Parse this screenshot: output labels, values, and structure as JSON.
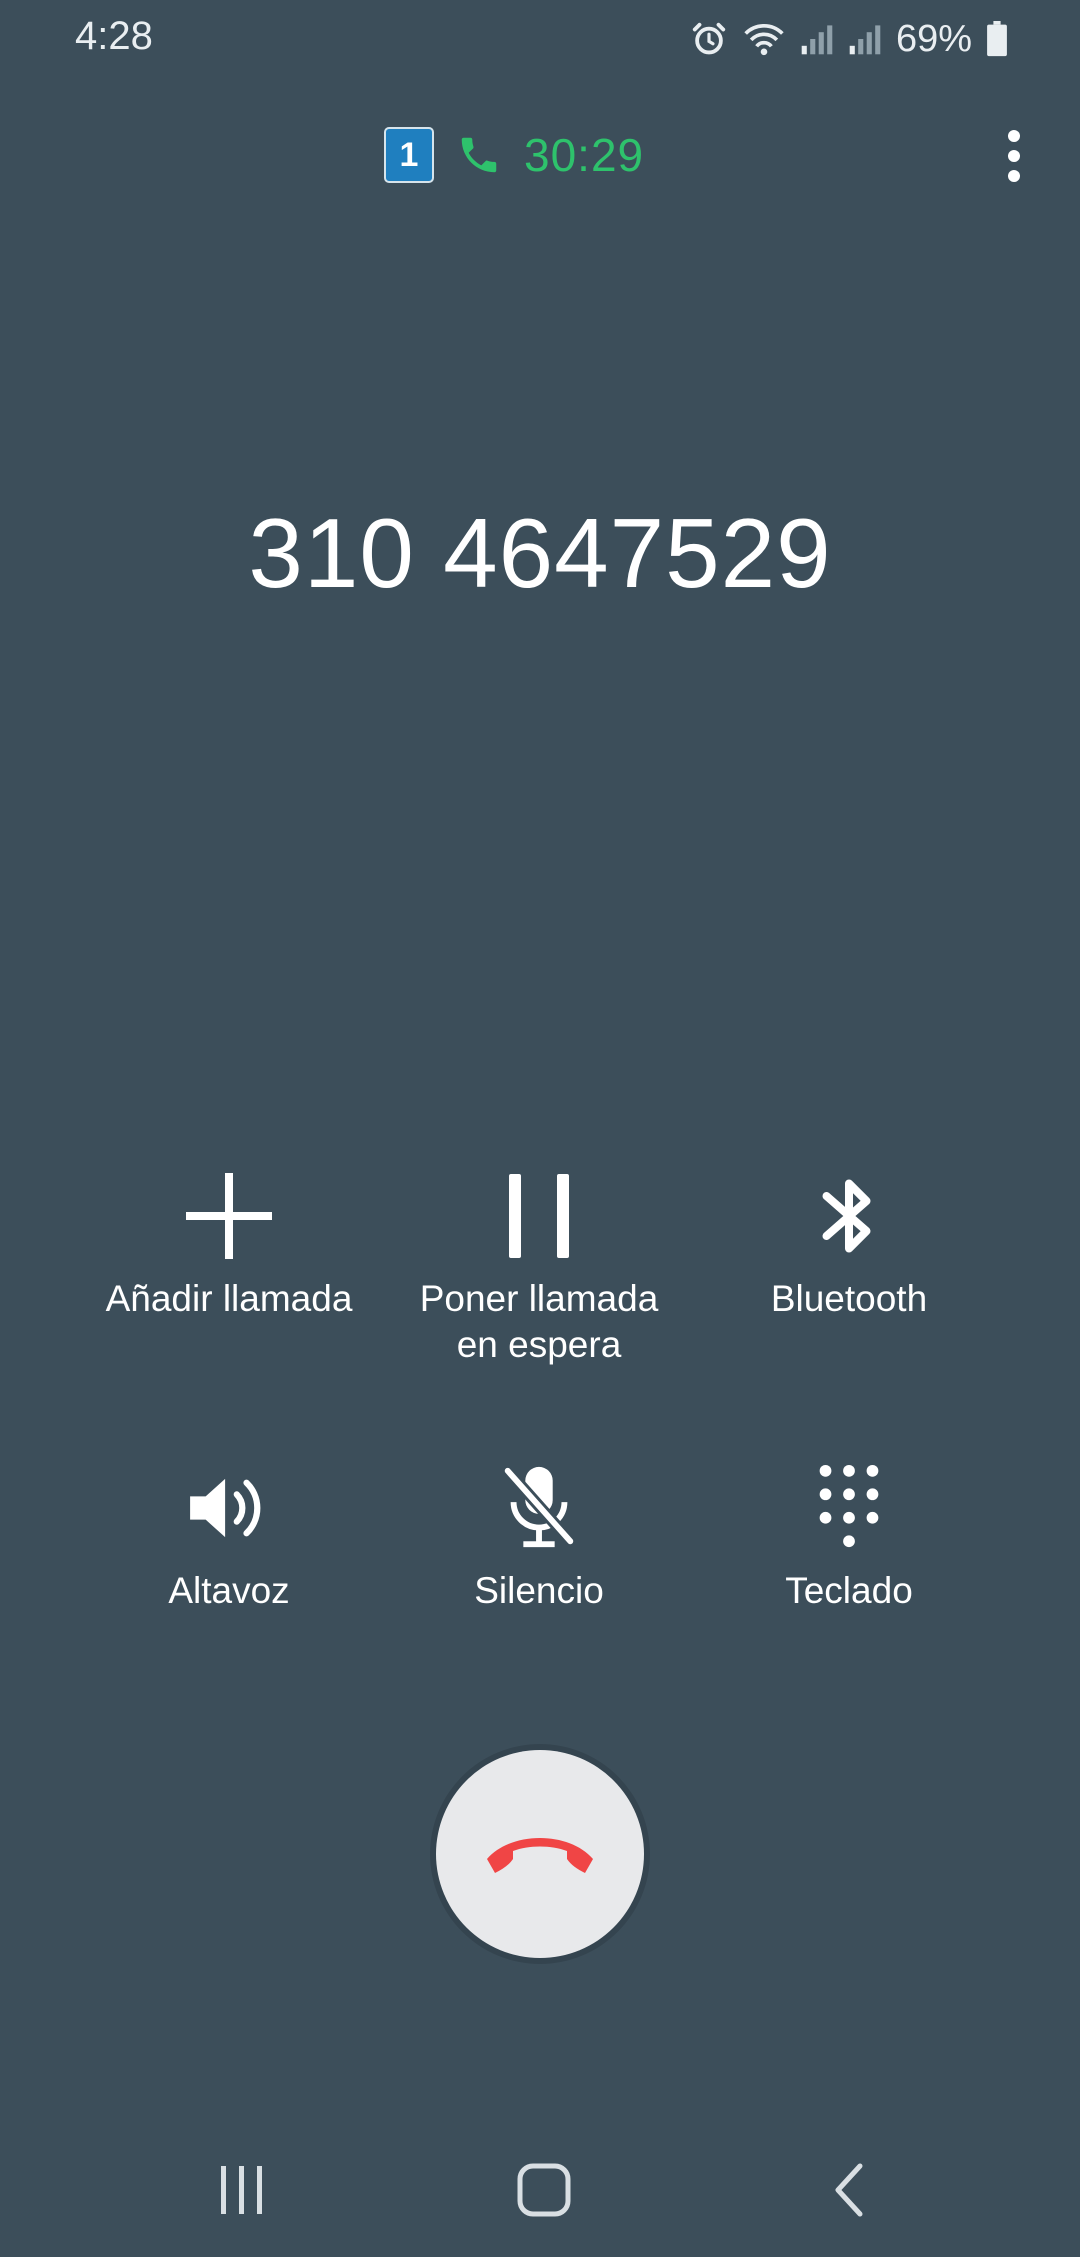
{
  "status_bar": {
    "time": "4:28",
    "battery_percent": "69%",
    "icons": [
      "alarm-icon",
      "wifi-icon",
      "signal-icon",
      "signal-icon",
      "battery-icon"
    ]
  },
  "call": {
    "sim_slot": "1",
    "timer": "30:29",
    "phone_number": "310 4647529",
    "timer_color": "#2ec26c"
  },
  "controls": [
    {
      "label": "Añadir llamada",
      "icon": "add-icon"
    },
    {
      "label": "Poner llamada\nen espera",
      "line1": "Poner llamada",
      "line2": "en espera",
      "icon": "pause-icon"
    },
    {
      "label": "Bluetooth",
      "icon": "bluetooth-icon"
    },
    {
      "label": "Altavoz",
      "icon": "speaker-icon"
    },
    {
      "label": "Silencio",
      "icon": "mute-mic-icon"
    },
    {
      "label": "Teclado",
      "icon": "keypad-icon"
    }
  ],
  "end_call": {
    "icon": "end-call-icon",
    "color": "#f04545"
  },
  "nav_bar": {
    "icons": [
      "recents-icon",
      "home-icon",
      "back-icon"
    ]
  }
}
